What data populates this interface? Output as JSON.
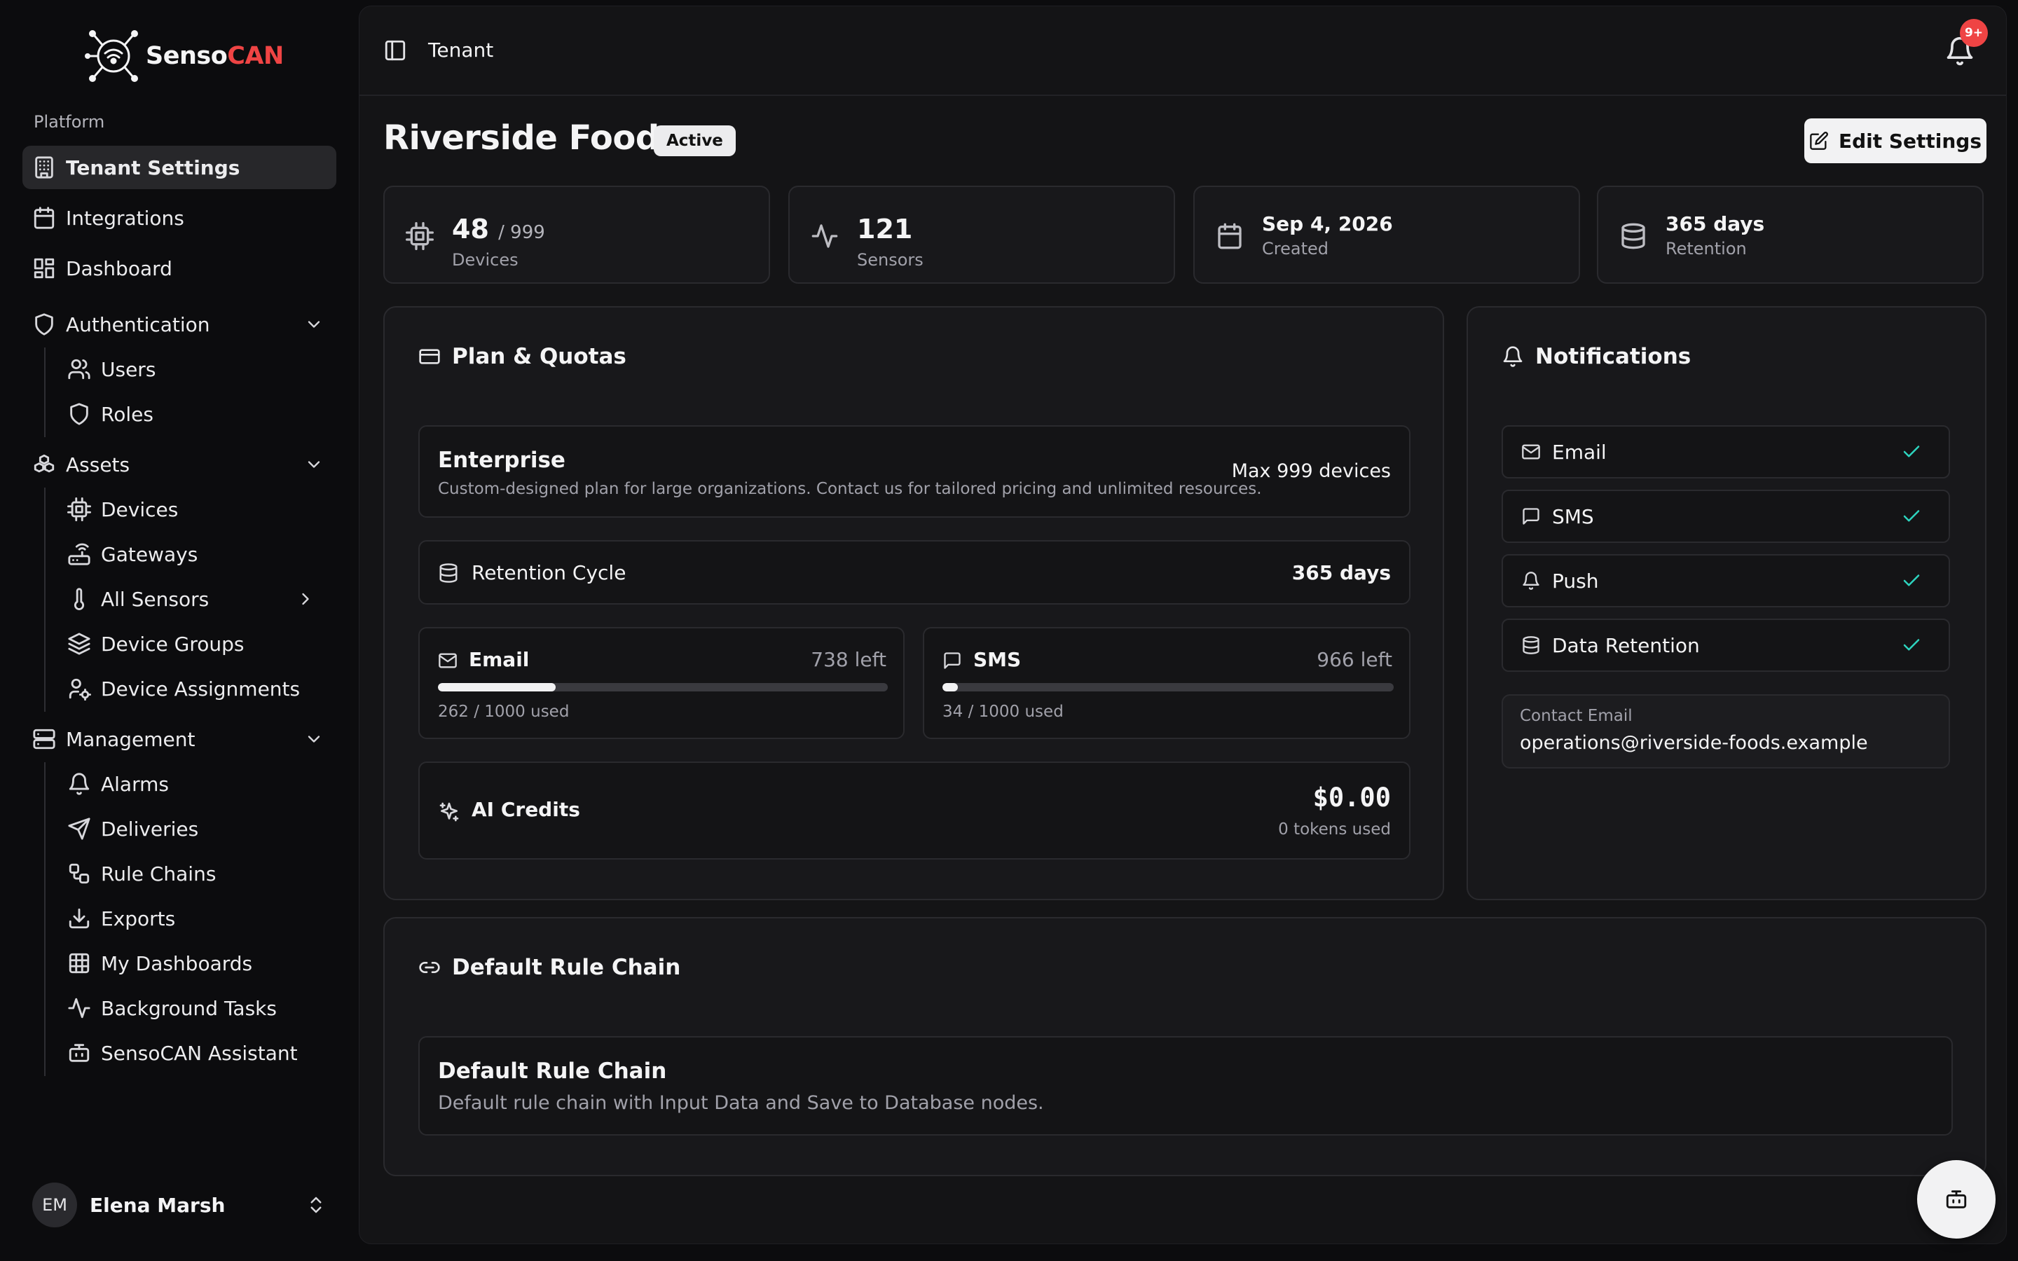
{
  "brand": {
    "part1": "Senso",
    "part2": "CAN",
    "accent": "#ef4444"
  },
  "sidebar": {
    "group_label": "Platform",
    "items": [
      {
        "label": "Tenant Settings",
        "icon": "building-icon",
        "active": true
      },
      {
        "label": "Integrations",
        "icon": "calendar-icon"
      },
      {
        "label": "Dashboard",
        "icon": "layout-grid-icon"
      },
      {
        "label": "Authentication",
        "icon": "shield-icon",
        "expanded": true
      },
      {
        "label": "Users",
        "icon": "users-icon"
      },
      {
        "label": "Roles",
        "icon": "shield-icon"
      },
      {
        "label": "Assets",
        "icon": "boxes-icon",
        "expanded": true
      },
      {
        "label": "Devices",
        "icon": "cpu-icon"
      },
      {
        "label": "Gateways",
        "icon": "router-icon"
      },
      {
        "label": "All Sensors",
        "icon": "thermometer-icon"
      },
      {
        "label": "Device Groups",
        "icon": "layers-icon"
      },
      {
        "label": "Device Assignments",
        "icon": "user-cog-icon"
      },
      {
        "label": "Management",
        "icon": "server-icon",
        "expanded": true
      },
      {
        "label": "Alarms",
        "icon": "bell-icon"
      },
      {
        "label": "Deliveries",
        "icon": "send-icon"
      },
      {
        "label": "Rule Chains",
        "icon": "workflow-icon"
      },
      {
        "label": "Exports",
        "icon": "download-icon"
      },
      {
        "label": "My Dashboards",
        "icon": "table-icon"
      },
      {
        "label": "Background Tasks",
        "icon": "activity-icon"
      },
      {
        "label": "SensoCAN Assistant",
        "icon": "bot-icon"
      }
    ]
  },
  "user": {
    "initials": "EM",
    "name": "Elena Marsh"
  },
  "header": {
    "breadcrumb": "Tenant",
    "notification_badge": "9+"
  },
  "page": {
    "title": "Riverside Foods",
    "status": "Active",
    "edit_label": "Edit Settings"
  },
  "stats": {
    "devices": {
      "value": "48",
      "max": "/ 999",
      "label": "Devices"
    },
    "sensors": {
      "value": "121",
      "label": "Sensors"
    },
    "created": {
      "value": "Sep 4, 2026",
      "label": "Created"
    },
    "retention": {
      "value": "365 days",
      "label": "Retention"
    }
  },
  "plan": {
    "title": "Plan & Quotas",
    "name": "Enterprise",
    "description": "Custom-designed plan for large organizations. Contact us for tailored pricing and unlimited resources.",
    "max_devices": "Max 999 devices",
    "retention_label": "Retention Cycle",
    "retention_value": "365 days",
    "email": {
      "label": "Email",
      "left": "738 left",
      "used_text": "262 / 1000 used",
      "used_fraction": 0.262
    },
    "sms": {
      "label": "SMS",
      "left": "966 left",
      "used_text": "34 / 1000 used",
      "used_fraction": 0.034
    },
    "ai": {
      "label": "AI Credits",
      "amount": "$0.00",
      "tokens": "0 tokens used"
    }
  },
  "notifications": {
    "title": "Notifications",
    "channels": [
      {
        "label": "Email",
        "icon": "mail-icon",
        "enabled": true
      },
      {
        "label": "SMS",
        "icon": "message-icon",
        "enabled": true
      },
      {
        "label": "Push",
        "icon": "bell-icon",
        "enabled": true
      },
      {
        "label": "Data Retention",
        "icon": "database-icon",
        "enabled": true
      }
    ],
    "contact_label": "Contact Email",
    "contact_value": "operations@riverside-foods.example"
  },
  "rule_chain": {
    "title": "Default Rule Chain",
    "name": "Default Rule Chain",
    "description": "Default rule chain with Input Data and Save to Database nodes."
  },
  "colors": {
    "background": "#0c0c0e",
    "panel": "#141416",
    "card": "#18181b",
    "check": "#2dd4bf",
    "badge": "#ef4444"
  }
}
